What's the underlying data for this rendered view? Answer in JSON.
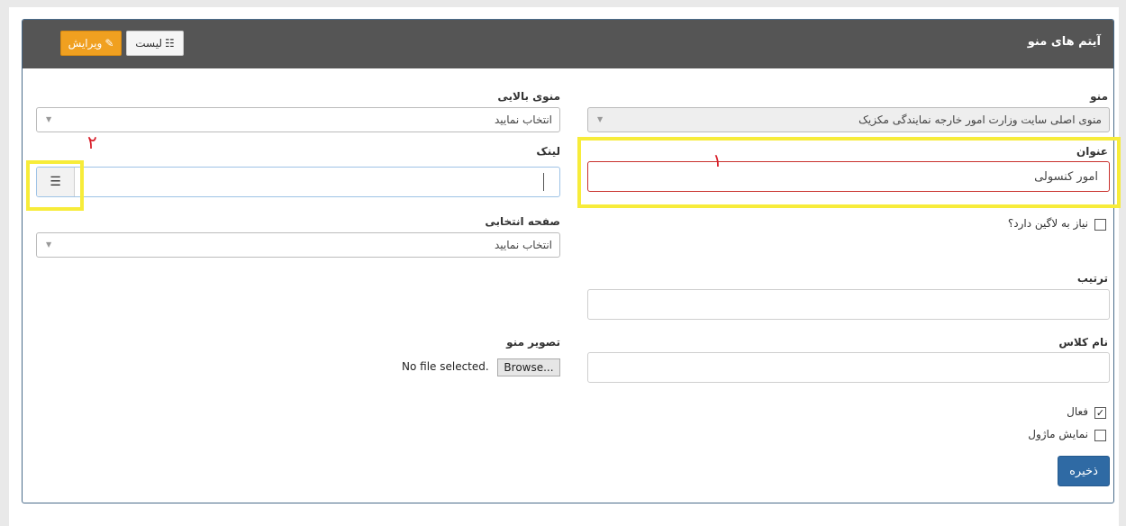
{
  "header": {
    "title": "آیتم های منو",
    "list_button": "لیست",
    "edit_button": "ویرایش"
  },
  "fields": {
    "menu": {
      "label": "منو",
      "value": "منوی اصلی سایت وزارت امور خارجه نمایندگی مکزیک"
    },
    "parent_menu": {
      "label": "منوی بالایی",
      "value": "انتخاب نمایید"
    },
    "title": {
      "label": "عنوان",
      "value": "امور کنسولی"
    },
    "link": {
      "label": "لینک",
      "value": ""
    },
    "needs_login": {
      "label": "نیاز به لاگین دارد؟",
      "checked": false
    },
    "selected_page": {
      "label": "صفحه انتخابی",
      "value": "انتخاب نمایید"
    },
    "order": {
      "label": "ترتیب",
      "value": ""
    },
    "class_name": {
      "label": "نام کلاس",
      "value": ""
    },
    "menu_image": {
      "label": "تصویر منو",
      "browse_label": "Browse...",
      "status": "No file selected."
    },
    "active": {
      "label": "فعال",
      "checked": true
    },
    "show_module": {
      "label": "نمایش ماژول",
      "checked": false
    }
  },
  "annotations": {
    "marker_1": "۱",
    "marker_2": "۲",
    "highlight_color": "#f7ec3a"
  },
  "save_button": "ذخیره",
  "colors": {
    "header_bg": "#555555",
    "edit_button": "#f0a020",
    "save_button": "#2f6aa4",
    "annotation": "#d91f2a"
  }
}
